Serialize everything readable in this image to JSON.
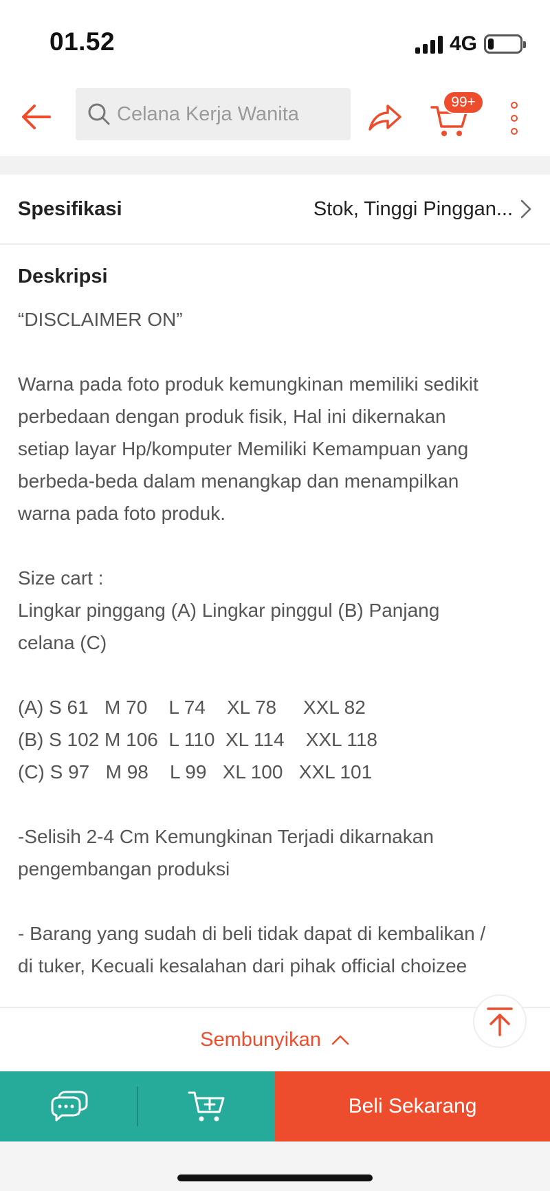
{
  "status_bar": {
    "time": "01.52",
    "network": "4G",
    "battery_level": 0.18
  },
  "header": {
    "search_placeholder": "Celana Kerja Wanita",
    "cart_badge": "99+",
    "icons": [
      "back-arrow-icon",
      "search-icon",
      "share-icon",
      "cart-icon",
      "more-vertical-icon"
    ]
  },
  "colors": {
    "brand": "#ee4d2d",
    "teal": "#26aa99"
  },
  "spesifikasi": {
    "label": "Spesifikasi",
    "value": "Stok, Tinggi Pinggan..."
  },
  "deskripsi": {
    "title": "Deskripsi",
    "lines": [
      "“DISCLAIMER ON”",
      "",
      "Warna pada foto produk kemungkinan memiliki sedikit",
      "perbedaan dengan produk fisik, Hal ini dikernakan",
      "setiap layar Hp/komputer Memiliki Kemampuan yang",
      "berbeda-beda dalam menangkap dan menampilkan",
      "warna pada foto produk.",
      "",
      "Size cart :",
      "Lingkar pinggang (A) Lingkar pinggul (B) Panjang",
      "celana (C)",
      "",
      "(A) S 61   M 70    L 74    XL 78     XXL 82",
      "(B) S 102 M 106  L 110  XL 114    XXL 118",
      "(C) S 97   M 98    L 99   XL 100   XXL 101",
      "",
      "-Selisih 2-4 Cm Kemungkinan Terjadi dikarnakan",
      "pengembangan produksi",
      "",
      "- Barang yang sudah di beli tidak dapat di kembalikan /",
      "di tuker, Kecuali kesalahan dari pihak official choizee"
    ]
  },
  "hide_bar": {
    "label": "Sembunyikan"
  },
  "bottom_bar": {
    "buy_label": "Beli Sekarang"
  }
}
